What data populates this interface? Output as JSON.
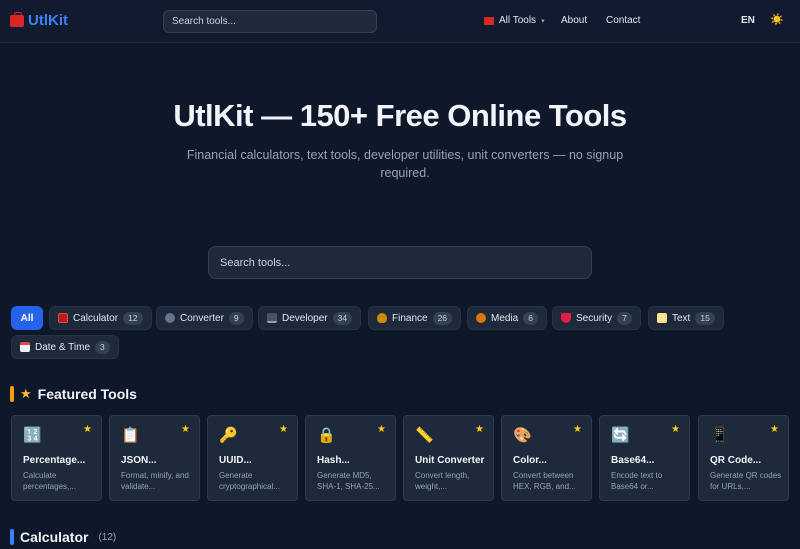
{
  "header": {
    "logo_text": "UtlKit",
    "search_placeholder": "Search tools...",
    "nav_all_tools": "All Tools",
    "nav_about": "About",
    "nav_contact": "Contact",
    "language": "EN",
    "theme_icon": "☀️"
  },
  "hero": {
    "title": "UtlKit — 150+ Free Online Tools",
    "subtitle": "Financial calculators, text tools, developer utilities, unit converters — no signup required.",
    "search_placeholder": "Search tools..."
  },
  "categories": [
    {
      "label": "All",
      "count": "",
      "icon": "",
      "active": true
    },
    {
      "label": "Calculator",
      "count": "12",
      "icon": "calculator-icon"
    },
    {
      "label": "Converter",
      "count": "9",
      "icon": "converter-icon"
    },
    {
      "label": "Developer",
      "count": "34",
      "icon": "laptop-icon"
    },
    {
      "label": "Finance",
      "count": "26",
      "icon": "money-bag-icon"
    },
    {
      "label": "Media",
      "count": "6",
      "icon": "palette-icon"
    },
    {
      "label": "Security",
      "count": "7",
      "icon": "shield-icon"
    },
    {
      "label": "Text",
      "count": "15",
      "icon": "memo-icon"
    },
    {
      "label": "Date & Time",
      "count": "3",
      "icon": "calendar-icon"
    }
  ],
  "featured": {
    "title": "Featured Tools",
    "tools": [
      {
        "icon": "🔢",
        "name": "Percentage...",
        "desc": "Calculate percentages,..."
      },
      {
        "icon": "📋",
        "name": "JSON...",
        "desc": "Format, minify, and validate..."
      },
      {
        "icon": "🔑",
        "name": "UUID...",
        "desc": "Generate cryptographical..."
      },
      {
        "icon": "🔒",
        "name": "Hash...",
        "desc": "Generate MD5, SHA-1, SHA-25..."
      },
      {
        "icon": "📏",
        "name": "Unit Converter",
        "desc": "Convert length, weight,..."
      },
      {
        "icon": "🎨",
        "name": "Color...",
        "desc": "Convert between HEX, RGB, and..."
      },
      {
        "icon": "🔄",
        "name": "Base64...",
        "desc": "Encode text to Base64 or..."
      },
      {
        "icon": "📱",
        "name": "QR Code...",
        "desc": "Generate QR codes for URLs,..."
      }
    ]
  },
  "calculator_section": {
    "title": "Calculator",
    "count": "(12)"
  },
  "colors": {
    "accent": "#2563eb",
    "featured_bar": "#f59e0b",
    "calculator_bar": "#3b82f6",
    "star": "#facc15"
  }
}
